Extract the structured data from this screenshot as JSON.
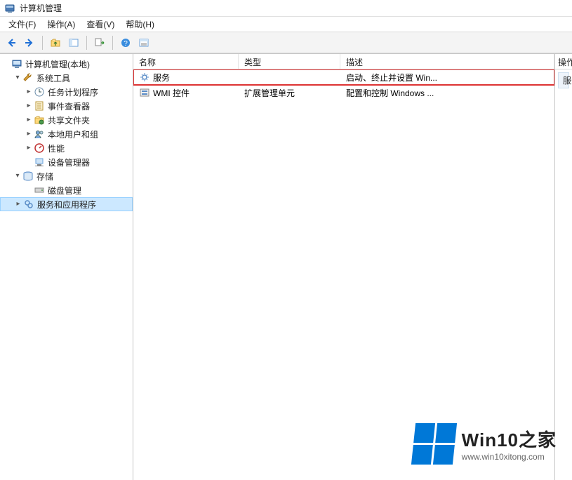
{
  "window": {
    "title": "计算机管理"
  },
  "menu": {
    "file": "文件(F)",
    "action": "操作(A)",
    "view": "查看(V)",
    "help": "帮助(H)"
  },
  "tree": {
    "root": "计算机管理(本地)",
    "system_tools": "系统工具",
    "task_scheduler": "任务计划程序",
    "event_viewer": "事件查看器",
    "shared_folders": "共享文件夹",
    "local_users": "本地用户和组",
    "performance": "性能",
    "device_manager": "设备管理器",
    "storage": "存储",
    "disk_management": "磁盘管理",
    "services_apps": "服务和应用程序"
  },
  "list": {
    "columns": {
      "name": "名称",
      "type": "类型",
      "desc": "描述"
    },
    "rows": [
      {
        "name": "服务",
        "type": "",
        "desc": "启动、终止并设置 Win...",
        "highlight": true
      },
      {
        "name": "WMI 控件",
        "type": "扩展管理单元",
        "desc": "配置和控制 Windows ...",
        "highlight": false
      }
    ]
  },
  "actions": {
    "header": "操作",
    "item": "服务"
  },
  "watermark": {
    "title": "Win10之家",
    "url": "www.win10xitong.com"
  }
}
